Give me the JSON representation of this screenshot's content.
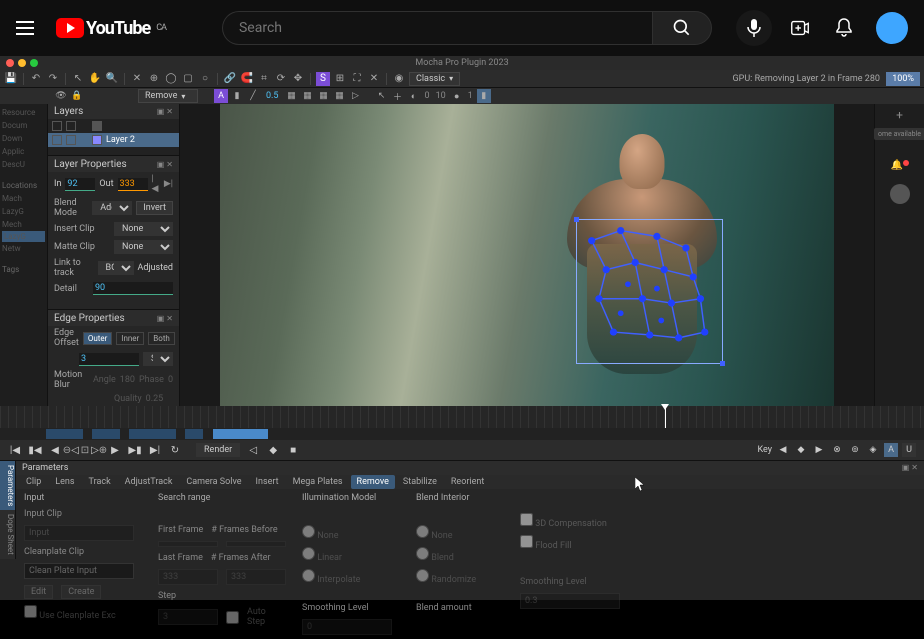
{
  "youtube": {
    "search_placeholder": "Search",
    "country": "CA",
    "brand": "YouTube"
  },
  "app": {
    "title": "Mocha Pro Plugin 2023",
    "gpu_status": "GPU: Removing Layer 2 in Frame 280",
    "gpu_percent": "100%",
    "view_mode": "Classic",
    "chrome_badge": "ome available"
  },
  "toolbar2": {
    "mode": "Remove",
    "scale": "0.5",
    "angle": "0",
    "num1": "10",
    "num2": "1"
  },
  "layers": {
    "title": "Layers",
    "items": [
      {
        "name": "",
        "selected": false
      },
      {
        "name": "Layer 2",
        "selected": true
      }
    ]
  },
  "layerProps": {
    "title": "Layer Properties",
    "in_label": "In",
    "in": "92",
    "out_label": "Out",
    "out": "333",
    "blend_label": "Blend Mode",
    "blend": "Add",
    "invert": "Invert",
    "insert_label": "Insert Clip",
    "insert": "None",
    "matte_label": "Matte Clip",
    "matte": "None",
    "link_label": "Link to track",
    "link": "BG",
    "adjusted": "Adjusted",
    "detail_label": "Detail",
    "detail": "90"
  },
  "edgeProps": {
    "title": "Edge Properties",
    "offset_label": "Edge Offset",
    "tabs": [
      "Outer",
      "Inner",
      "Both"
    ],
    "set": "Set",
    "value": "3",
    "motion_blur": "Motion Blur",
    "angle_label": "Angle",
    "angle": "180",
    "phase_label": "Phase",
    "phase": "0",
    "quality_label": "Quality",
    "quality": "0.25"
  },
  "leftStrip": {
    "items": [
      "Resource",
      "Docum",
      "Down",
      "Applic",
      "DescU"
    ],
    "locations": "Locations",
    "loc_items": [
      "Mach",
      "LazyG",
      "Mech"
    ],
    "lazy": "LazyG",
    "netw": "Netw",
    "tags": "Tags"
  },
  "transport": {
    "render": "Render",
    "key": "Key"
  },
  "params": {
    "title": "Parameters",
    "sidetabs": [
      "Parameters",
      "Dope Sheet"
    ],
    "tabs": [
      "Clip",
      "Lens",
      "Track",
      "AdjustTrack",
      "Camera Solve",
      "Insert",
      "Mega Plates",
      "Remove",
      "Stabilize",
      "Reorient"
    ],
    "active_tab": "Remove",
    "input": "Input",
    "input_clip": "Input Clip",
    "input_val": "Input",
    "cleanplate": "Cleanplate Clip",
    "cleanplate_val": "Clean Plate Input",
    "use_cp": "Use Cleanplate Exc",
    "btn_edit": "Edit",
    "btn_create": "Create",
    "search_range": "Search range",
    "first_frame": "First Frame",
    "frames_before": "# Frames Before",
    "last_frame": "Last Frame",
    "frames_after": "# Frames After",
    "last_val": "333",
    "after_val": "333",
    "step": "Step",
    "step_val": "3",
    "autostep": "Auto Step",
    "illum": "Illumination Model",
    "none": "None",
    "interp": "Interpolate",
    "linear": "Linear",
    "smoothing": "Smoothing Level",
    "smooth_val": "0",
    "blend_interior": "Blend Interior",
    "blend": "Blend",
    "randomize": "Randomize",
    "blend_amount": "Blend amount",
    "3d_comp": "3D Compensation",
    "flood_fill": "Flood Fill",
    "smoothing2": "Smoothing Level",
    "smooth2_val": "0.3"
  }
}
